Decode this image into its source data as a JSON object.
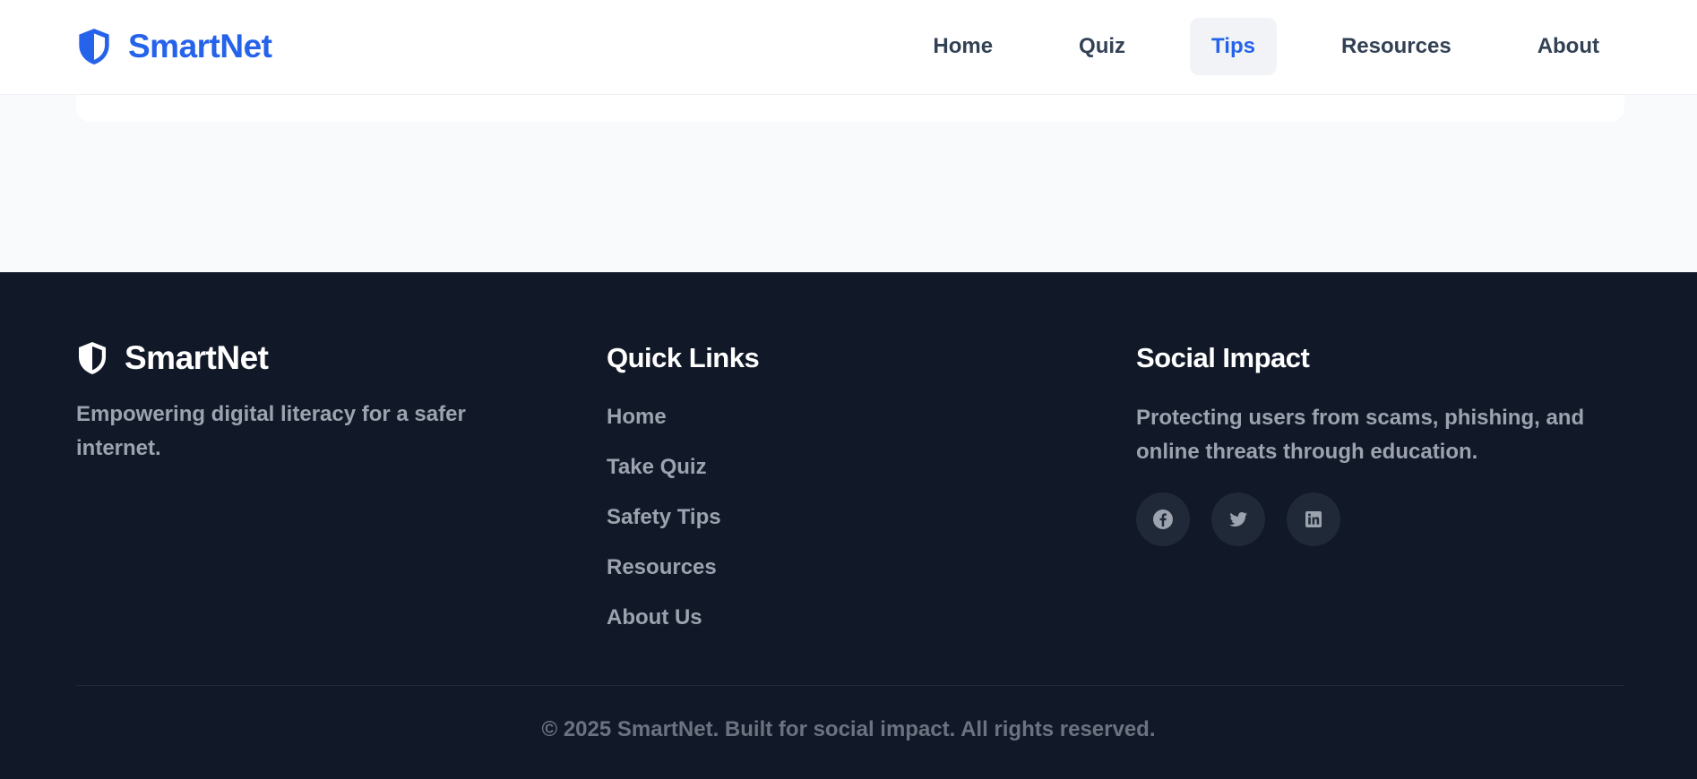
{
  "header": {
    "brand_name": "SmartNet",
    "brand_icon": "shield-icon",
    "nav": [
      {
        "label": "Home",
        "active": false
      },
      {
        "label": "Quiz",
        "active": false
      },
      {
        "label": "Tips",
        "active": true
      },
      {
        "label": "Resources",
        "active": false
      },
      {
        "label": "About",
        "active": false
      }
    ]
  },
  "footer": {
    "brand": {
      "name": "SmartNet",
      "icon": "shield-icon",
      "tagline": "Empowering digital literacy for a safer internet."
    },
    "quick_links": {
      "heading": "Quick Links",
      "items": [
        "Home",
        "Take Quiz",
        "Safety Tips",
        "Resources",
        "About Us"
      ]
    },
    "social_impact": {
      "heading": "Social Impact",
      "text": "Protecting users from scams, phishing, and online threats through education.",
      "socials": [
        "facebook-icon",
        "twitter-icon",
        "linkedin-icon"
      ]
    },
    "copyright": "© 2025 SmartNet. Built for social impact. All rights reserved."
  },
  "colors": {
    "accent": "#2563eb",
    "header_bg": "#ffffff",
    "page_bg": "#f8fafc",
    "footer_bg": "#111827",
    "footer_text": "#9ca3af",
    "nav_active_bg": "#f1f3f6"
  }
}
